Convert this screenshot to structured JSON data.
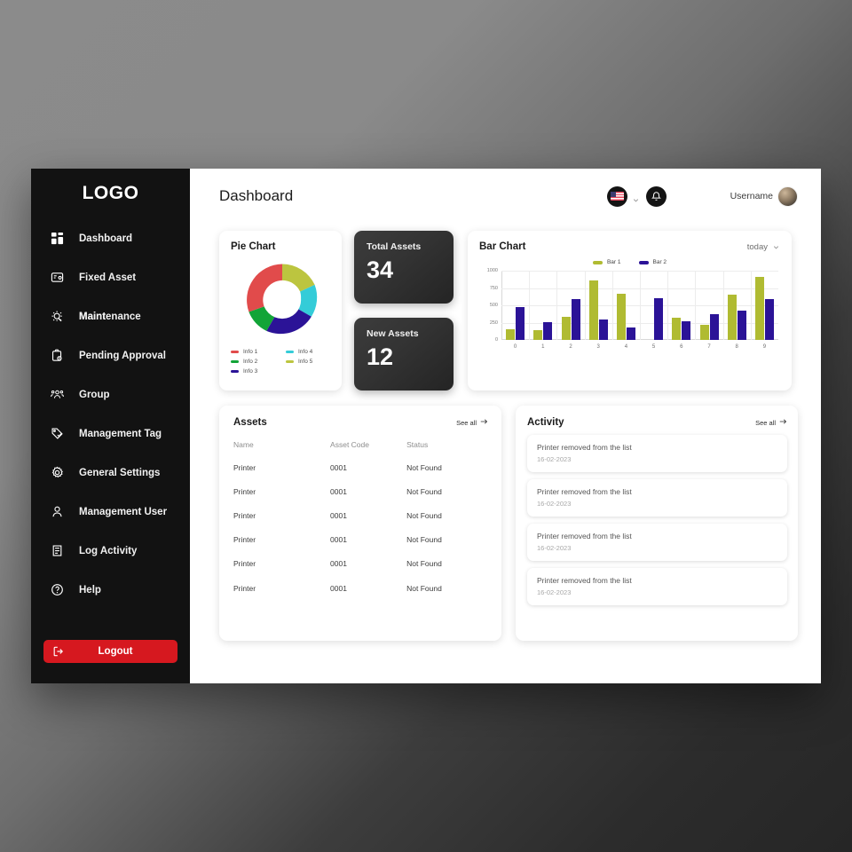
{
  "app": {
    "logo": "LOGO"
  },
  "sidebar": {
    "items": [
      {
        "label": "Dashboard",
        "icon": "grid-dashboard-icon",
        "name": "sidebar-item-dashboard"
      },
      {
        "label": "Fixed Asset",
        "icon": "fixed-asset-icon",
        "name": "sidebar-item-fixed-asset"
      },
      {
        "label": "Maintenance",
        "overlay": "Maint",
        "icon": "gear-wrench-icon",
        "name": "sidebar-item-maintenance"
      },
      {
        "label": "Pending Approval",
        "icon": "clipboard-clock-icon",
        "name": "sidebar-item-pending-approval"
      },
      {
        "label": "Group",
        "icon": "people-group-icon",
        "name": "sidebar-item-group"
      },
      {
        "label": "Management Tag",
        "icon": "tag-check-icon",
        "name": "sidebar-item-management-tag"
      },
      {
        "label": "General Settings",
        "icon": "gear-icon",
        "name": "sidebar-item-general-settings"
      },
      {
        "label": "Management User",
        "icon": "user-icon",
        "name": "sidebar-item-management-user"
      },
      {
        "label": "Log Activity",
        "icon": "scroll-log-icon",
        "name": "sidebar-item-log-activity"
      },
      {
        "label": "Help",
        "icon": "question-circle-icon",
        "name": "sidebar-item-help"
      }
    ],
    "logout": {
      "label": "Logout",
      "icon": "logout-icon",
      "color": "#d6181f"
    }
  },
  "header": {
    "title": "Dashboard",
    "language_icon": "us-flag-icon",
    "language_chevron": "chevron-down-icon",
    "notification_icon": "bell-icon",
    "username": "Username",
    "avatar": "user-avatar"
  },
  "pie_card": {
    "title": "Pie Chart"
  },
  "stats": [
    {
      "label": "Total Assets",
      "value": "34"
    },
    {
      "label": "New Assets",
      "value": "12"
    }
  ],
  "bar_card": {
    "title": "Bar Chart",
    "range_label": "today",
    "range_chevron": "chevron-down-icon"
  },
  "assets": {
    "title": "Assets",
    "see_all": "See all",
    "see_all_icon": "arrow-right-icon",
    "columns": [
      "Name",
      "Asset Code",
      "Status"
    ],
    "rows": [
      [
        "Printer",
        "0001",
        "Not Found"
      ],
      [
        "Printer",
        "0001",
        "Not Found"
      ],
      [
        "Printer",
        "0001",
        "Not Found"
      ],
      [
        "Printer",
        "0001",
        "Not Found"
      ],
      [
        "Printer",
        "0001",
        "Not Found"
      ],
      [
        "Printer",
        "0001",
        "Not Found"
      ]
    ]
  },
  "activity": {
    "title": "Activity",
    "see_all": "See all",
    "see_all_icon": "arrow-right-icon",
    "items": [
      {
        "text": "Printer removed from the list",
        "date": "16-02-2023"
      },
      {
        "text": "Printer removed from the list",
        "date": "16-02-2023"
      },
      {
        "text": "Printer removed from the list",
        "date": "16-02-2023"
      },
      {
        "text": "Printer removed from the list",
        "date": "16-02-2023"
      }
    ]
  },
  "colors": {
    "sidebar_bg": "#121212",
    "logout_red": "#d6181f",
    "stat_card_bg": "#333333",
    "pie_red": "#e14b4b",
    "pie_green": "#12a437",
    "pie_navy": "#2b1397",
    "pie_cyan": "#34ccd8",
    "pie_olive": "#bcc53f",
    "bar1_olive": "#b0bb32",
    "bar2_navy": "#2b1397"
  },
  "chart_data": [
    {
      "type": "pie",
      "title": "Pie Chart",
      "subtype": "donut",
      "labels": [
        "Info 1",
        "Info 2",
        "Info 3",
        "Info 4",
        "Info 5"
      ],
      "values": [
        36,
        11,
        19,
        16,
        18
      ],
      "colors": [
        "#e14b4b",
        "#12a437",
        "#2b1397",
        "#34ccd8",
        "#bcc53f"
      ],
      "legend": "bottom",
      "start_angle_deg": 0,
      "direction": "clockwise",
      "inner_radius_ratio": 0.55
    },
    {
      "type": "bar",
      "title": "Bar Chart",
      "categories": [
        "0",
        "1",
        "2",
        "3",
        "4",
        "5",
        "6",
        "7",
        "8",
        "9"
      ],
      "series": [
        {
          "name": "Bar 1",
          "color": "#b0bb32",
          "values": [
            155,
            145,
            330,
            860,
            665,
            0,
            325,
            215,
            660,
            910
          ]
        },
        {
          "name": "Bar 2",
          "color": "#2b1397",
          "values": [
            480,
            255,
            595,
            290,
            180,
            605,
            265,
            375,
            420,
            590
          ]
        }
      ],
      "xlabel": "",
      "ylabel": "",
      "ylim": [
        0,
        1000
      ],
      "yticks": [
        0,
        250,
        500,
        750,
        1000
      ],
      "grid": true,
      "legend": "top-center"
    }
  ]
}
